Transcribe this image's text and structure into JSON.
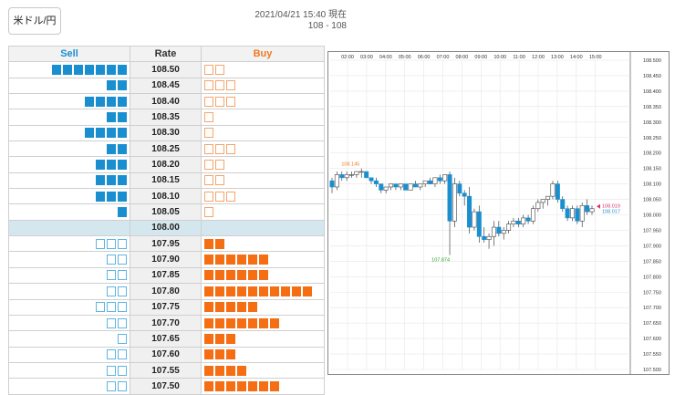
{
  "header": {
    "pair": "米ドル/円",
    "datetime": "2021/04/21 15:40 現在",
    "price_range": "108 - 108"
  },
  "book": {
    "headers": {
      "sell": "Sell",
      "rate": "Rate",
      "buy": "Buy"
    },
    "current_rate": "108.00",
    "rows": [
      {
        "rate": "108.50",
        "sell_fill": 7,
        "sell_empty": 0,
        "buy_fill": 0,
        "buy_empty": 2
      },
      {
        "rate": "108.45",
        "sell_fill": 2,
        "sell_empty": 0,
        "buy_fill": 0,
        "buy_empty": 3
      },
      {
        "rate": "108.40",
        "sell_fill": 4,
        "sell_empty": 0,
        "buy_fill": 0,
        "buy_empty": 3
      },
      {
        "rate": "108.35",
        "sell_fill": 2,
        "sell_empty": 0,
        "buy_fill": 0,
        "buy_empty": 1
      },
      {
        "rate": "108.30",
        "sell_fill": 4,
        "sell_empty": 0,
        "buy_fill": 0,
        "buy_empty": 1
      },
      {
        "rate": "108.25",
        "sell_fill": 2,
        "sell_empty": 0,
        "buy_fill": 0,
        "buy_empty": 3
      },
      {
        "rate": "108.20",
        "sell_fill": 3,
        "sell_empty": 0,
        "buy_fill": 0,
        "buy_empty": 2
      },
      {
        "rate": "108.15",
        "sell_fill": 3,
        "sell_empty": 0,
        "buy_fill": 0,
        "buy_empty": 2
      },
      {
        "rate": "108.10",
        "sell_fill": 3,
        "sell_empty": 0,
        "buy_fill": 0,
        "buy_empty": 3
      },
      {
        "rate": "108.05",
        "sell_fill": 1,
        "sell_empty": 0,
        "buy_fill": 0,
        "buy_empty": 1
      },
      {
        "rate": "108.00",
        "sell_fill": 0,
        "sell_empty": 0,
        "buy_fill": 0,
        "buy_empty": 0
      },
      {
        "rate": "107.95",
        "sell_fill": 0,
        "sell_empty": 3,
        "buy_fill": 2,
        "buy_empty": 0
      },
      {
        "rate": "107.90",
        "sell_fill": 0,
        "sell_empty": 2,
        "buy_fill": 6,
        "buy_empty": 0
      },
      {
        "rate": "107.85",
        "sell_fill": 0,
        "sell_empty": 2,
        "buy_fill": 6,
        "buy_empty": 0
      },
      {
        "rate": "107.80",
        "sell_fill": 0,
        "sell_empty": 2,
        "buy_fill": 10,
        "buy_empty": 0
      },
      {
        "rate": "107.75",
        "sell_fill": 0,
        "sell_empty": 3,
        "buy_fill": 5,
        "buy_empty": 0
      },
      {
        "rate": "107.70",
        "sell_fill": 0,
        "sell_empty": 2,
        "buy_fill": 7,
        "buy_empty": 0
      },
      {
        "rate": "107.65",
        "sell_fill": 0,
        "sell_empty": 1,
        "buy_fill": 3,
        "buy_empty": 0
      },
      {
        "rate": "107.60",
        "sell_fill": 0,
        "sell_empty": 2,
        "buy_fill": 3,
        "buy_empty": 0
      },
      {
        "rate": "107.55",
        "sell_fill": 0,
        "sell_empty": 2,
        "buy_fill": 4,
        "buy_empty": 0
      },
      {
        "rate": "107.50",
        "sell_fill": 0,
        "sell_empty": 2,
        "buy_fill": 7,
        "buy_empty": 0
      }
    ]
  },
  "chart_data": {
    "type": "candlestick",
    "x_ticks": [
      "02:00",
      "03:00",
      "04:00",
      "05:00",
      "06:00",
      "07:00",
      "08:00",
      "09:00",
      "10:00",
      "11:00",
      "12:00",
      "13:00",
      "14:00",
      "15:00"
    ],
    "y_ticks": [
      "108.500",
      "108.450",
      "108.400",
      "108.350",
      "108.300",
      "108.250",
      "108.200",
      "108.150",
      "108.100",
      "108.050",
      "108.000",
      "107.950",
      "107.900",
      "107.850",
      "107.800",
      "107.750",
      "107.700",
      "107.650",
      "107.600",
      "107.550",
      "107.500"
    ],
    "ylim": [
      107.5,
      108.5
    ],
    "annotations": {
      "high_label": "108.145",
      "low_label": "107.874",
      "ask_label": "108.019",
      "bid_label": "108.017",
      "high_color": "#f07a24",
      "low_color": "#2aa52a",
      "ask_color": "#e0306a",
      "bid_color": "#1a8fd0"
    },
    "colors": {
      "up": "#ffffff",
      "down": "#1a8fd0"
    },
    "candles": [
      [
        108.11,
        108.12,
        108.07,
        108.09
      ],
      [
        108.09,
        108.14,
        108.08,
        108.13
      ],
      [
        108.13,
        108.14,
        108.11,
        108.12
      ],
      [
        108.12,
        108.14,
        108.11,
        108.13
      ],
      [
        108.13,
        108.14,
        108.12,
        108.13
      ],
      [
        108.13,
        108.14,
        108.12,
        108.14
      ],
      [
        108.14,
        108.15,
        108.12,
        108.14
      ],
      [
        108.14,
        108.14,
        108.12,
        108.12
      ],
      [
        108.12,
        108.12,
        108.1,
        108.11
      ],
      [
        108.11,
        108.12,
        108.09,
        108.1
      ],
      [
        108.1,
        108.1,
        108.07,
        108.08
      ],
      [
        108.08,
        108.09,
        108.07,
        108.09
      ],
      [
        108.09,
        108.1,
        108.08,
        108.1
      ],
      [
        108.1,
        108.1,
        108.08,
        108.09
      ],
      [
        108.09,
        108.1,
        108.08,
        108.1
      ],
      [
        108.1,
        108.1,
        108.08,
        108.08
      ],
      [
        108.08,
        108.1,
        108.08,
        108.1
      ],
      [
        108.1,
        108.11,
        108.09,
        108.09
      ],
      [
        108.09,
        108.1,
        108.08,
        108.1
      ],
      [
        108.1,
        108.11,
        108.09,
        108.11
      ],
      [
        108.11,
        108.12,
        108.1,
        108.1
      ],
      [
        108.1,
        108.12,
        108.09,
        108.12
      ],
      [
        108.12,
        108.13,
        108.1,
        108.11
      ],
      [
        108.11,
        108.13,
        108.1,
        108.13
      ],
      [
        108.13,
        108.14,
        107.87,
        107.98
      ],
      [
        107.98,
        108.12,
        107.96,
        108.1
      ],
      [
        108.1,
        108.11,
        108.06,
        108.07
      ],
      [
        108.07,
        108.08,
        108.03,
        108.06
      ],
      [
        108.06,
        108.09,
        107.94,
        107.96
      ],
      [
        107.96,
        108.02,
        107.95,
        108.01
      ],
      [
        108.01,
        108.03,
        107.91,
        107.93
      ],
      [
        107.93,
        107.96,
        107.91,
        107.92
      ],
      [
        107.92,
        107.94,
        107.89,
        107.93
      ],
      [
        107.93,
        107.98,
        107.9,
        107.96
      ],
      [
        107.96,
        107.98,
        107.93,
        107.94
      ],
      [
        107.94,
        107.96,
        107.92,
        107.95
      ],
      [
        107.95,
        107.98,
        107.94,
        107.97
      ],
      [
        107.97,
        107.99,
        107.96,
        107.98
      ],
      [
        107.98,
        107.99,
        107.96,
        107.97
      ],
      [
        107.97,
        108.0,
        107.96,
        107.99
      ],
      [
        107.99,
        108.0,
        107.97,
        107.98
      ],
      [
        107.98,
        108.03,
        107.97,
        108.02
      ],
      [
        108.02,
        108.05,
        108.01,
        108.04
      ],
      [
        108.04,
        108.05,
        108.02,
        108.05
      ],
      [
        108.05,
        108.06,
        108.03,
        108.06
      ],
      [
        108.06,
        108.11,
        108.05,
        108.1
      ],
      [
        108.1,
        108.11,
        108.04,
        108.05
      ],
      [
        108.05,
        108.06,
        108.01,
        108.02
      ],
      [
        108.02,
        108.03,
        107.98,
        107.99
      ],
      [
        107.99,
        108.03,
        107.98,
        108.02
      ],
      [
        108.02,
        108.03,
        107.97,
        107.98
      ],
      [
        107.98,
        108.04,
        107.96,
        108.03
      ],
      [
        108.03,
        108.05,
        108.0,
        108.01
      ],
      [
        108.01,
        108.03,
        108.0,
        108.02
      ]
    ]
  }
}
